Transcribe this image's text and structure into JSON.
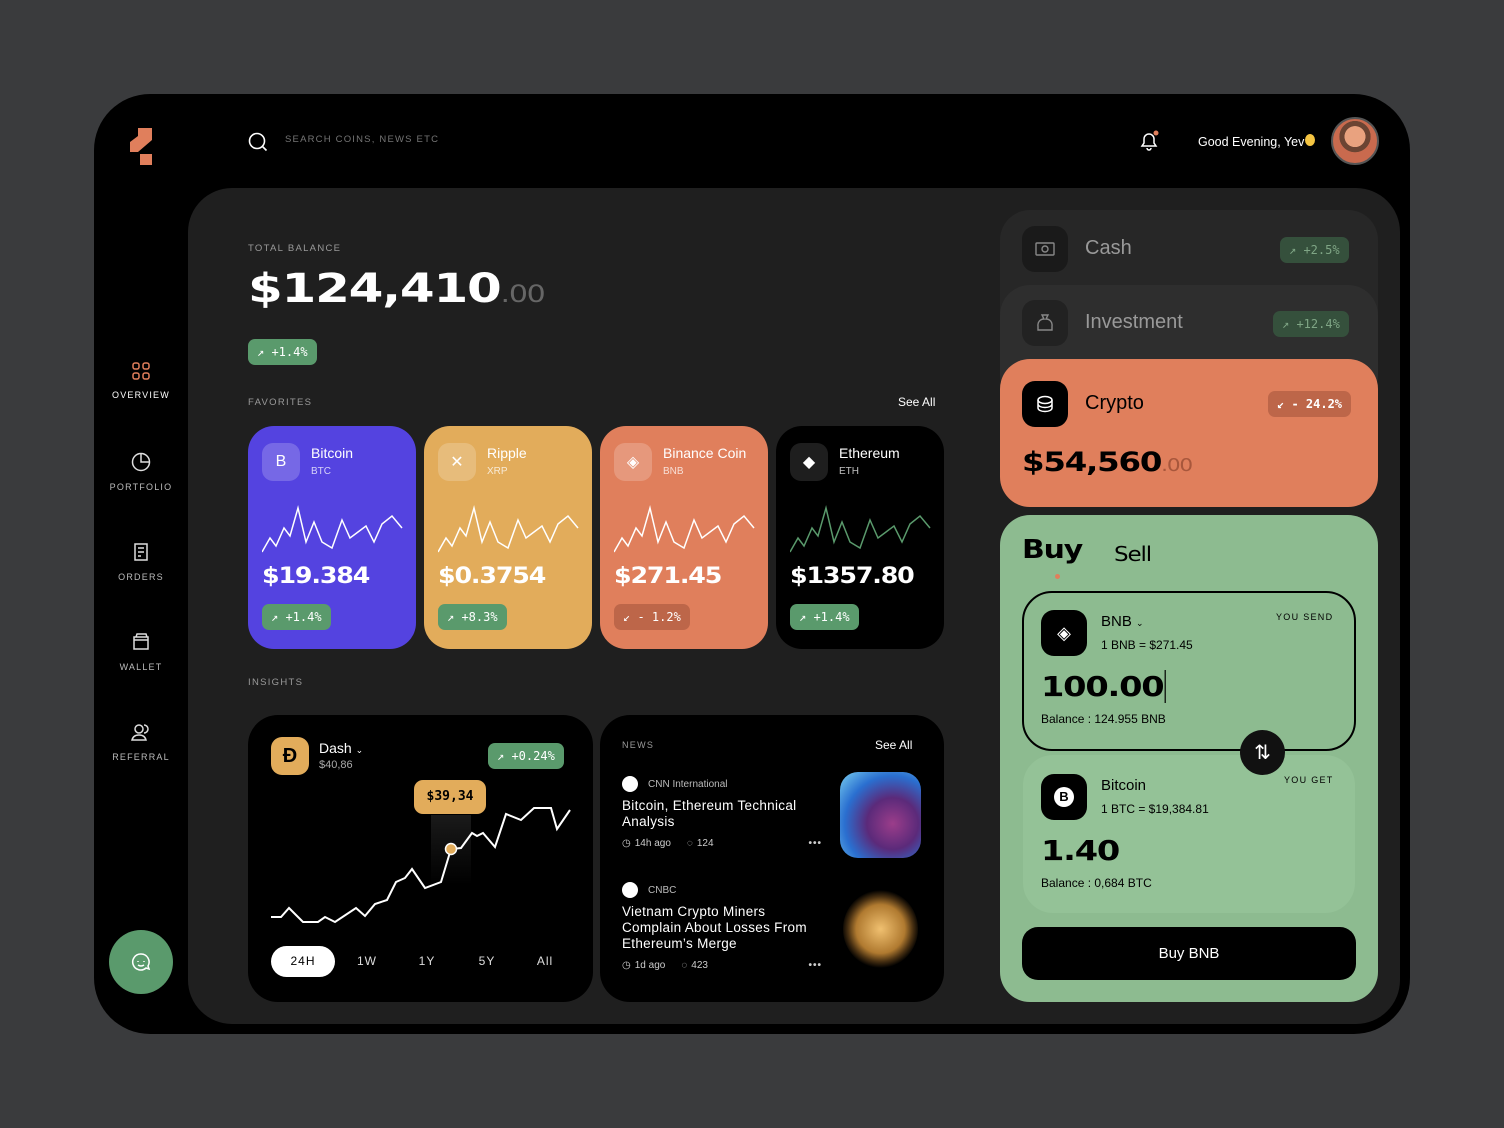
{
  "header": {
    "search_placeholder": "SEARCH COINS, NEWS ETC",
    "greeting": "Good Evening, Yev"
  },
  "sidebar": {
    "items": [
      {
        "label": "OVERVIEW",
        "active": true
      },
      {
        "label": "PORTFOLIO"
      },
      {
        "label": "ORDERS"
      },
      {
        "label": "WALLET"
      },
      {
        "label": "REFERRAL"
      }
    ]
  },
  "balance": {
    "label": "TOTAL BALANCE",
    "value": "$124,410",
    "cents": ".00",
    "change": "+1.4%"
  },
  "favorites": {
    "label": "FAVORITES",
    "see_all": "See All",
    "items": [
      {
        "name": "Bitcoin",
        "symbol": "BTC",
        "price": "$19.384",
        "change": "+1.4%",
        "dir": "up",
        "color": "#5443e0"
      },
      {
        "name": "Ripple",
        "symbol": "XRP",
        "price": "$0.3754",
        "change": "+8.3%",
        "dir": "up",
        "color": "#e2ac5b"
      },
      {
        "name": "Binance Coin",
        "symbol": "BNB",
        "price": "$271.45",
        "change": "- 1.2%",
        "dir": "down",
        "color": "#e07f5c"
      },
      {
        "name": "Ethereum",
        "symbol": "ETH",
        "price": "$1357.80",
        "change": "+1.4%",
        "dir": "up",
        "color": "#000000"
      }
    ]
  },
  "insights": {
    "label": "INSIGHTS",
    "coin": "Dash",
    "price": "$40,86",
    "change": "+0.24%",
    "tooltip": "$39,34",
    "ranges": [
      "24H",
      "1W",
      "1Y",
      "5Y",
      "All"
    ],
    "active_range": "24H"
  },
  "news": {
    "label": "NEWS",
    "see_all": "See All",
    "items": [
      {
        "source": "CNN International",
        "title": "Bitcoin, Ethereum Technical Analysis",
        "time": "14h ago",
        "comments": "124"
      },
      {
        "source": "CNBC",
        "title": "Vietnam Crypto Miners Complain About Losses From Ethereum’s Merge",
        "time": "1d ago",
        "comments": "423"
      }
    ]
  },
  "accounts": [
    {
      "name": "Cash",
      "change": "+2.5%"
    },
    {
      "name": "Investment",
      "change": "+12.4%"
    },
    {
      "name": "Crypto",
      "change": "- 24.2%",
      "value": "$54,560",
      "cents": ".00"
    }
  ],
  "trade": {
    "tabs": [
      "Buy",
      "Sell"
    ],
    "active": "Buy",
    "send": {
      "label": "YOU SEND",
      "coin": "BNB",
      "rate": "1 BNB = $271.45",
      "amount": "100.00",
      "balance": "Balance : 124.955 BNB"
    },
    "get": {
      "label": "YOU GET",
      "coin": "Bitcoin",
      "rate": "1 BTC = $19,384.81",
      "amount": "1.40",
      "balance": "Balance : 0,684 BTC"
    },
    "button": "Buy BNB"
  },
  "colors": {
    "accent": "#e07f5c",
    "green": "#8dbb90",
    "badge_green": "#5a9a6c",
    "purple": "#5443e0",
    "yellow": "#e2ac5b"
  }
}
